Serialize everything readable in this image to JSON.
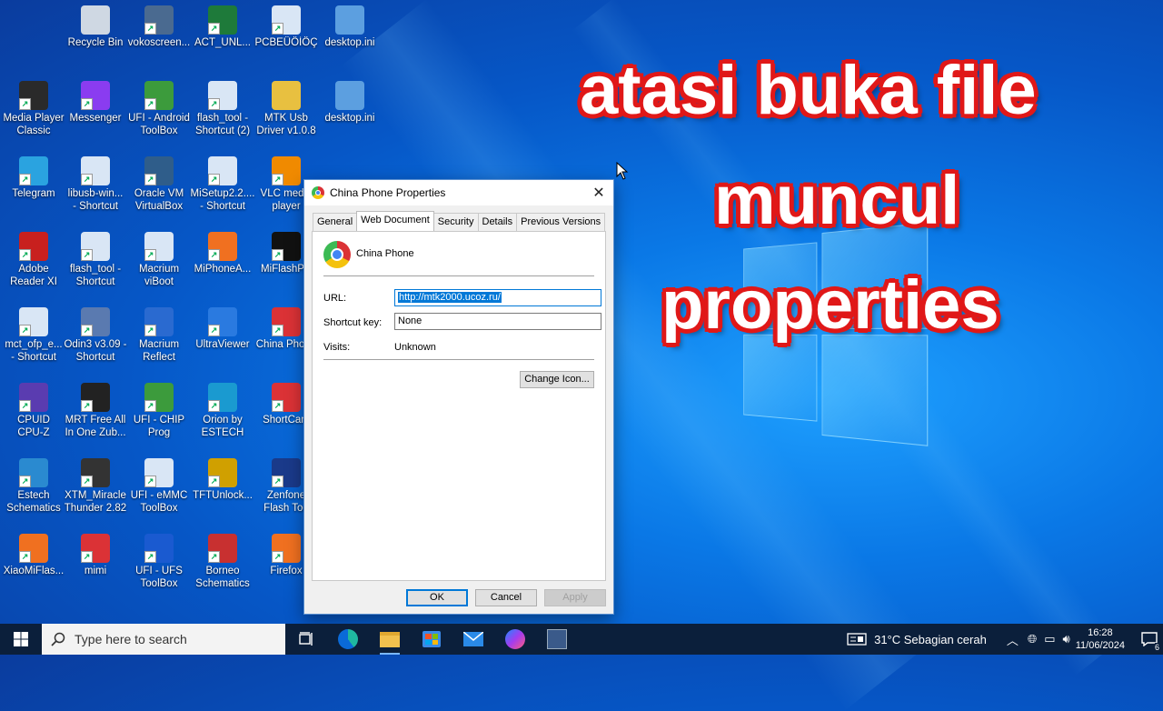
{
  "overlay": {
    "line1": "atasi buka file",
    "line2": "muncul",
    "line3": "properties"
  },
  "desktop": {
    "icons": [
      {
        "label": "Recycle Bin",
        "color": "#cfd8e3",
        "icon": "recycle-bin-icon"
      },
      {
        "label": "vokoscreen...",
        "color": "#4a6a90",
        "icon": "camera-icon"
      },
      {
        "label": "ACT_UNL...",
        "color": "#1e7a3a",
        "icon": "mtk-icon"
      },
      {
        "label": "PCBEÜÖİÖÇ",
        "color": "#d9e6f5",
        "icon": "shortcut-icon"
      },
      {
        "label": "desktop.ini",
        "color": "#5c9fe0",
        "icon": "settings-file-icon"
      },
      {
        "label": "Media Player\nClassic",
        "color": "#2a2a2a",
        "icon": "media-player-icon"
      },
      {
        "label": "Messenger",
        "color": "#8a3cf0",
        "icon": "messenger-icon"
      },
      {
        "label": "UFI - Android\nToolBox",
        "color": "#3c9b3c",
        "icon": "android-icon"
      },
      {
        "label": "flash_tool -\nShortcut (2)",
        "color": "#d9e6f5",
        "icon": "shortcut-icon"
      },
      {
        "label": "MTK Usb\nDriver v1.0.8",
        "color": "#e8c040",
        "icon": "folder-icon"
      },
      {
        "label": "desktop.ini",
        "color": "#5c9fe0",
        "icon": "settings-file-icon"
      },
      {
        "label": "Telegram",
        "color": "#2aa3e0",
        "icon": "telegram-icon"
      },
      {
        "label": "libusb-win...\n- Shortcut",
        "color": "#d9e6f5",
        "icon": "shortcut-icon"
      },
      {
        "label": "Oracle VM\nVirtualBox",
        "color": "#2f5d8a",
        "icon": "virtualbox-icon"
      },
      {
        "label": "MiSetup2.2....\n- Shortcut",
        "color": "#d9e6f5",
        "icon": "shortcut-icon"
      },
      {
        "label": "VLC media\nplayer",
        "color": "#f08a00",
        "icon": "vlc-icon"
      },
      {
        "label": "Adobe\nReader XI",
        "color": "#c8201e",
        "icon": "pdf-icon"
      },
      {
        "label": "flash_tool -\nShortcut",
        "color": "#d9e6f5",
        "icon": "shortcut-icon"
      },
      {
        "label": "Macrium\nviBoot",
        "color": "#d9e6f5",
        "icon": "macrium-icon"
      },
      {
        "label": "MiPhoneA...",
        "color": "#f07020",
        "icon": "mi-icon"
      },
      {
        "label": "MiFlashP...",
        "color": "#111111",
        "icon": "miflash-icon"
      },
      {
        "label": "mct_ofp_e...\n- Shortcut",
        "color": "#d9e6f5",
        "icon": "shortcut-icon"
      },
      {
        "label": "Odin3 v3.09 -\nShortcut",
        "color": "#5a7ab0",
        "icon": "odin-icon"
      },
      {
        "label": "Macrium\nReflect",
        "color": "#2a6ad0",
        "icon": "macrium-reflect-icon"
      },
      {
        "label": "UltraViewer",
        "color": "#2a7ae0",
        "icon": "ultraviewer-icon"
      },
      {
        "label": "China Phone",
        "color": "#db3236",
        "icon": "chrome-icon"
      },
      {
        "label": "CPUID\nCPU-Z",
        "color": "#5a3cb0",
        "icon": "cpuz-icon"
      },
      {
        "label": "MRT Free All\nIn One Zub...",
        "color": "#222222",
        "icon": "mrt-icon"
      },
      {
        "label": "UFI - CHIP\nProg",
        "color": "#3c9b3c",
        "icon": "chip-icon"
      },
      {
        "label": "Orion by\nESTECH",
        "color": "#1a9ad0",
        "icon": "orion-icon"
      },
      {
        "label": "ShortCam",
        "color": "#db3236",
        "icon": "chrome-icon"
      },
      {
        "label": "Estech\nSchematics",
        "color": "#2a8ad0",
        "icon": "estech-icon"
      },
      {
        "label": "XTM_Miracle\nThunder 2.82",
        "color": "#333333",
        "icon": "miracle-icon"
      },
      {
        "label": "UFI - eMMC\nToolBox",
        "color": "#d9e6f5",
        "icon": "emmc-icon"
      },
      {
        "label": "TFTUnlock...",
        "color": "#d0a000",
        "icon": "tft-icon"
      },
      {
        "label": "Zenfone\nFlash Too",
        "color": "#1a3a8a",
        "icon": "zenfone-icon"
      },
      {
        "label": "XiaoMiFlas...",
        "color": "#f07020",
        "icon": "mi-icon"
      },
      {
        "label": "mimi",
        "color": "#db3236",
        "icon": "chrome-icon"
      },
      {
        "label": "UFI - UFS\nToolBox",
        "color": "#1a5ad0",
        "icon": "ufs-icon"
      },
      {
        "label": "Borneo\nSchematics",
        "color": "#c83030",
        "icon": "borneo-icon"
      },
      {
        "label": "Firefox",
        "color": "#f07020",
        "icon": "firefox-icon"
      }
    ]
  },
  "dialog": {
    "title": "China Phone Properties",
    "tabs": [
      "General",
      "Web Document",
      "Security",
      "Details",
      "Previous Versions"
    ],
    "name": "China Phone",
    "url_label": "URL:",
    "url_value": "http://mtk2000.ucoz.ru/",
    "shortcut_label": "Shortcut key:",
    "shortcut_value": "None",
    "visits_label": "Visits:",
    "visits_value": "Unknown",
    "change_icon": "Change Icon...",
    "ok": "OK",
    "cancel": "Cancel",
    "apply": "Apply"
  },
  "taskbar": {
    "search_placeholder": "Type here to search",
    "weather": "31°C  Sebagian cerah",
    "time": "16:28",
    "date": "11/06/2024",
    "notifications": "6"
  }
}
